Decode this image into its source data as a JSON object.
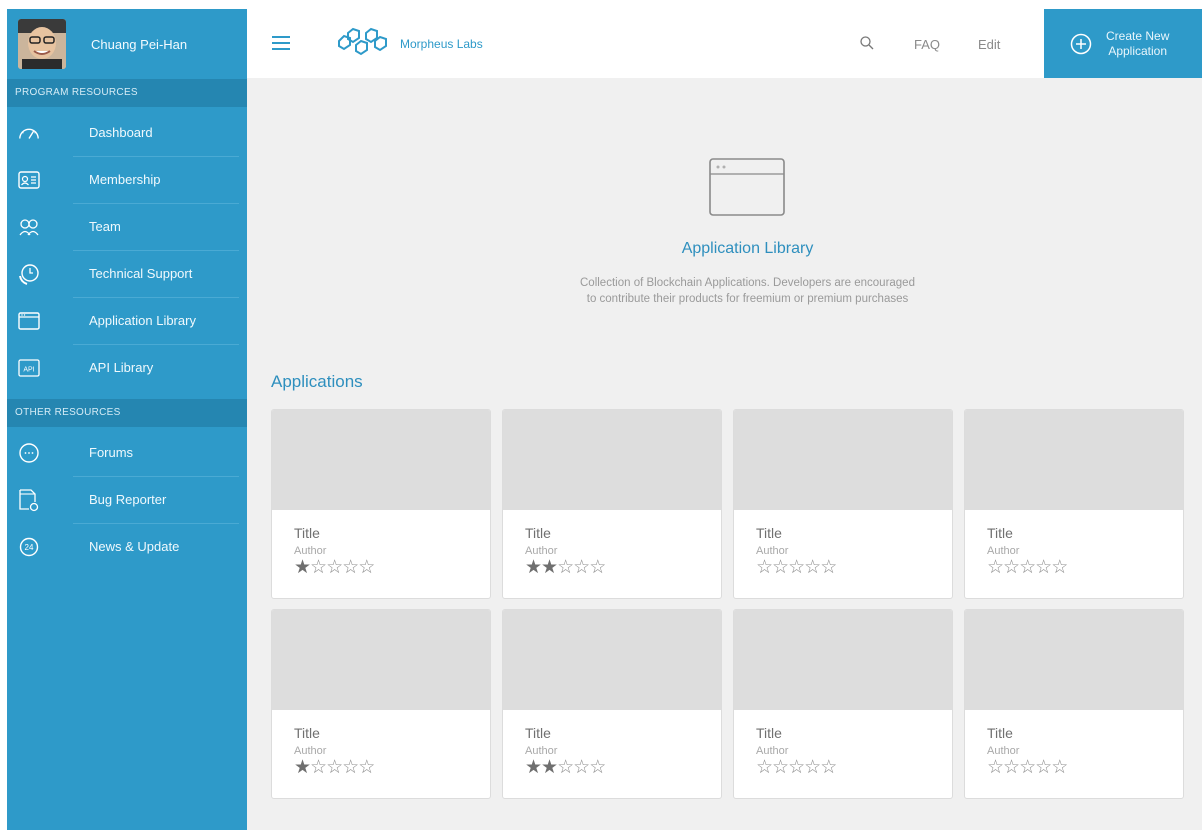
{
  "profile": {
    "name": "Chuang Pei-Han"
  },
  "sidebar": {
    "program_header": "PROGRAM RESOURCES",
    "program_items": [
      {
        "label": "Dashboard",
        "icon": "speedometer-icon"
      },
      {
        "label": "Membership",
        "icon": "id-card-icon"
      },
      {
        "label": "Team",
        "icon": "team-icon"
      },
      {
        "label": "Technical Support",
        "icon": "clock-phone-icon"
      },
      {
        "label": "Application Library",
        "icon": "app-window-icon"
      },
      {
        "label": "API Library",
        "icon": "api-icon"
      }
    ],
    "other_header": "OTHER RESOURCES",
    "other_items": [
      {
        "label": "Forums",
        "icon": "chat-bubble-icon"
      },
      {
        "label": "Bug Reporter",
        "icon": "bug-file-icon"
      },
      {
        "label": "News & Update",
        "icon": "24h-icon"
      }
    ]
  },
  "topbar": {
    "brand": "Morpheus Labs",
    "faq": "FAQ",
    "edit": "Edit",
    "create_line1": "Create New",
    "create_line2": "Application"
  },
  "hero": {
    "title": "Application Library",
    "desc_line1": "Collection of Blockchain Applications. Developers are encouraged",
    "desc_line2": "to contribute their products for freemium or premium purchases"
  },
  "applications": {
    "title": "Applications",
    "cards": [
      {
        "title": "Title",
        "author": "Author",
        "rating": 1
      },
      {
        "title": "Title",
        "author": "Author",
        "rating": 2
      },
      {
        "title": "Title",
        "author": "Author",
        "rating": 0
      },
      {
        "title": "Title",
        "author": "Author",
        "rating": 0
      },
      {
        "title": "Title",
        "author": "Author",
        "rating": 1
      },
      {
        "title": "Title",
        "author": "Author",
        "rating": 2
      },
      {
        "title": "Title",
        "author": "Author",
        "rating": 0
      },
      {
        "title": "Title",
        "author": "Author",
        "rating": 0
      }
    ]
  },
  "colors": {
    "primary": "#2e9ac9",
    "primary_dark": "#2586b1",
    "background": "#f0f0f0"
  }
}
